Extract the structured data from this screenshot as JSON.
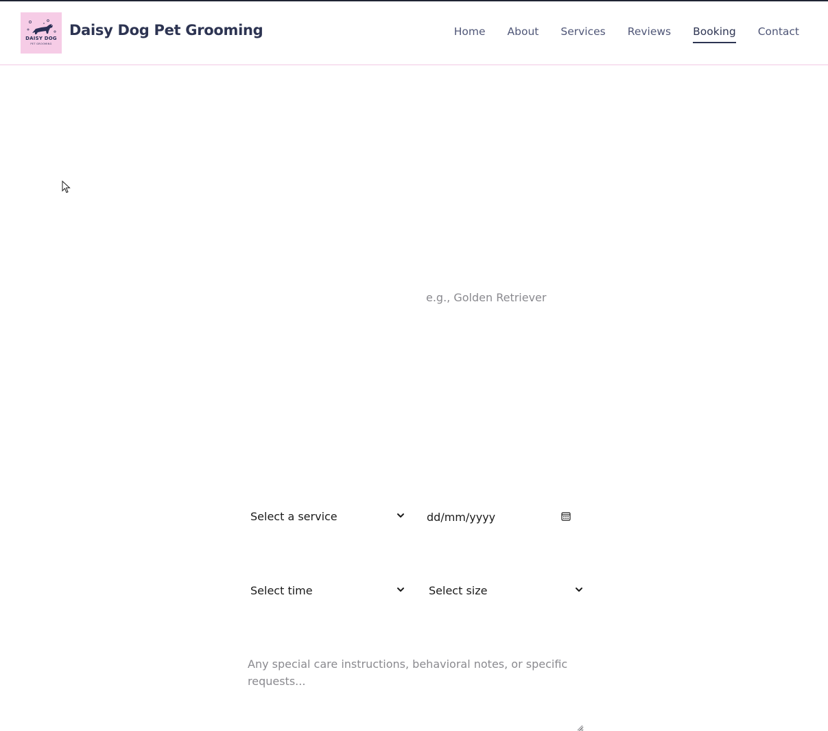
{
  "header": {
    "logo": {
      "text": "DAISY DOG",
      "subtext": "PET GROOMING"
    },
    "title": "Daisy Dog Pet Grooming",
    "nav": [
      {
        "label": "Home",
        "active": false
      },
      {
        "label": "About",
        "active": false
      },
      {
        "label": "Services",
        "active": false
      },
      {
        "label": "Reviews",
        "active": false
      },
      {
        "label": "Booking",
        "active": true
      },
      {
        "label": "Contact",
        "active": false
      }
    ]
  },
  "form": {
    "breed": {
      "value": "",
      "placeholder": "e.g., Golden Retriever"
    },
    "service": {
      "selected": "Select a service"
    },
    "date": {
      "value": "dd/mm/yyyy"
    },
    "time": {
      "selected": "Select time"
    },
    "size": {
      "selected": "Select size"
    },
    "notes": {
      "value": "",
      "placeholder": "Any special care instructions, behavioral notes, or specific requests..."
    }
  },
  "colors": {
    "brand_text": "#2d3452",
    "logo_bg": "#f6cce6",
    "header_border": "#f2c9e3",
    "placeholder": "#8a8a8f"
  },
  "icons": {
    "select_arrow": "chevron-down-icon",
    "date_picker": "calendar-icon",
    "cursor": "mouse-pointer-icon"
  }
}
